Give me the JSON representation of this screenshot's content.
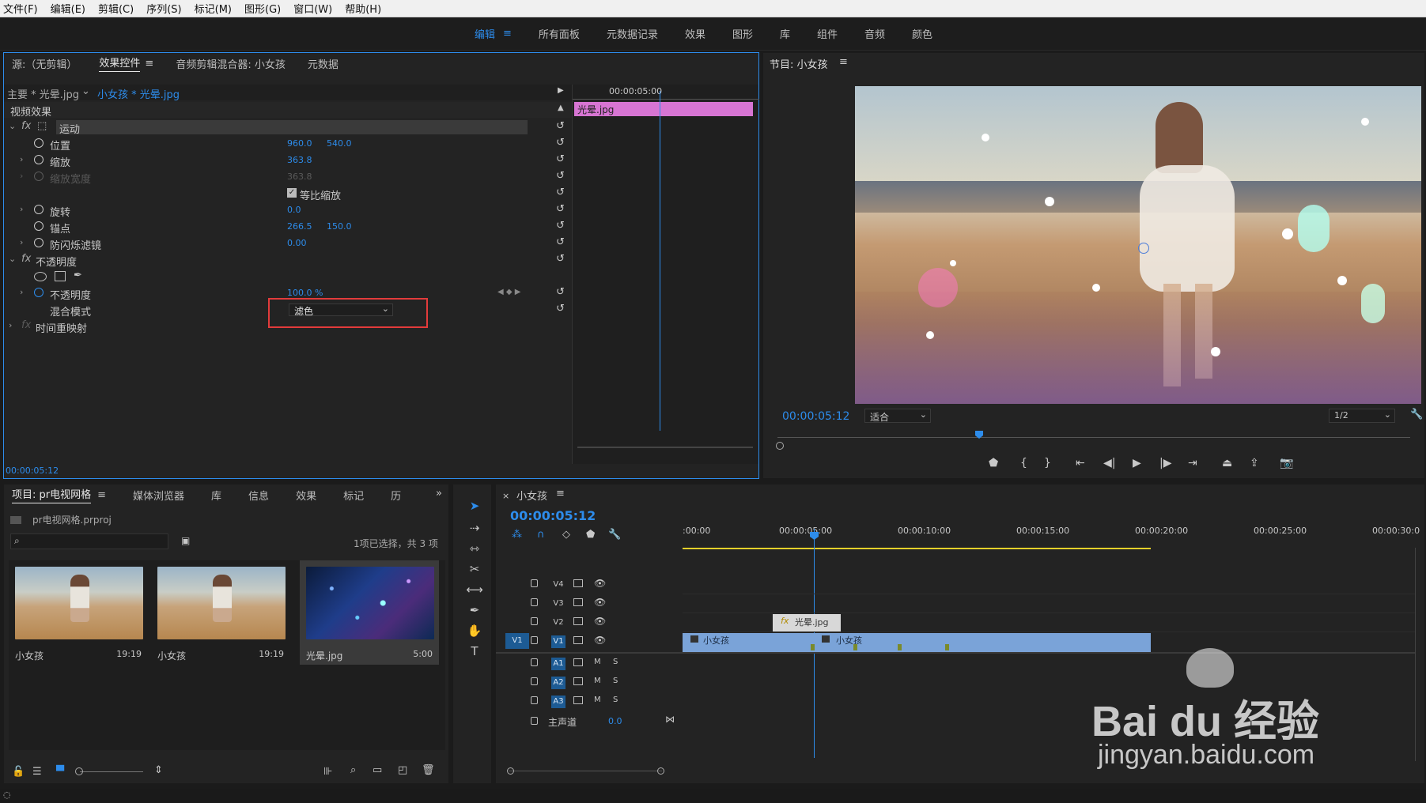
{
  "menu": [
    "文件(F)",
    "编辑(E)",
    "剪辑(C)",
    "序列(S)",
    "标记(M)",
    "图形(G)",
    "窗口(W)",
    "帮助(H)"
  ],
  "workspaces": [
    "编辑",
    "所有面板",
    "元数据记录",
    "效果",
    "图形",
    "库",
    "组件",
    "音频",
    "颜色"
  ],
  "effect_panel": {
    "tabs": [
      "源:（无剪辑）",
      "效果控件",
      "音频剪辑混合器: 小女孩",
      "元数据"
    ],
    "master": "主要 * 光晕.jpg",
    "clip": "小女孩 * 光晕.jpg",
    "mini_time": "00:00:05:00",
    "mini_clip": "光晕.jpg",
    "section": "视频效果",
    "motion": "运动",
    "position_label": "位置",
    "position_x": "960.0",
    "position_y": "540.0",
    "scale_label": "缩放",
    "scale": "363.8",
    "scale_width_label": "缩放宽度",
    "scale_width": "363.8",
    "uniform_label": "等比缩放",
    "rotation_label": "旋转",
    "rotation": "0.0",
    "anchor_label": "锚点",
    "anchor_x": "266.5",
    "anchor_y": "150.0",
    "flicker_label": "防闪烁滤镜",
    "flicker": "0.00",
    "opacity_section": "不透明度",
    "opacity_label": "不透明度",
    "opacity": "100.0 %",
    "blend_label": "混合模式",
    "blend": "滤色",
    "time_remap": "时间重映射",
    "footer_time": "00:00:05:12"
  },
  "program": {
    "title": "节目: 小女孩",
    "timecode": "00:00:05:12",
    "fit": "适合",
    "quality": "1/2"
  },
  "project": {
    "tabs": [
      "项目: pr电视网格",
      "媒体浏览器",
      "库",
      "信息",
      "效果",
      "标记",
      "历"
    ],
    "file": "pr电视网格.prproj",
    "selection": "1项已选择，共 3 项",
    "items": [
      {
        "name": "小女孩",
        "dur": "19:19"
      },
      {
        "name": "小女孩",
        "dur": "19:19"
      },
      {
        "name": "光晕.jpg",
        "dur": "5:00"
      }
    ]
  },
  "timeline": {
    "title": "小女孩",
    "timecode": "00:00:05:12",
    "ruler": [
      ":00:00",
      "00:00:05:00",
      "00:00:10:00",
      "00:00:15:00",
      "00:00:20:00",
      "00:00:25:00",
      "00:00:30:0"
    ],
    "video_tracks": [
      "V4",
      "V3",
      "V2",
      "V1"
    ],
    "audio_tracks": [
      "A1",
      "A2",
      "A3"
    ],
    "src_v1": "V1",
    "master": "主声道",
    "master_val": "0.0",
    "clip_v2": "光晕.jpg",
    "clip_v1a": "小女孩",
    "clip_v1b": "小女孩"
  },
  "watermark": {
    "brand": "Bai du 经验",
    "url": "jingyan.baidu.com"
  },
  "colors": {
    "accent": "#2d8ceb",
    "clip_pink": "#d775d3",
    "clip_blue": "#7aa3d8",
    "highlight_box": "#e23b3b"
  }
}
